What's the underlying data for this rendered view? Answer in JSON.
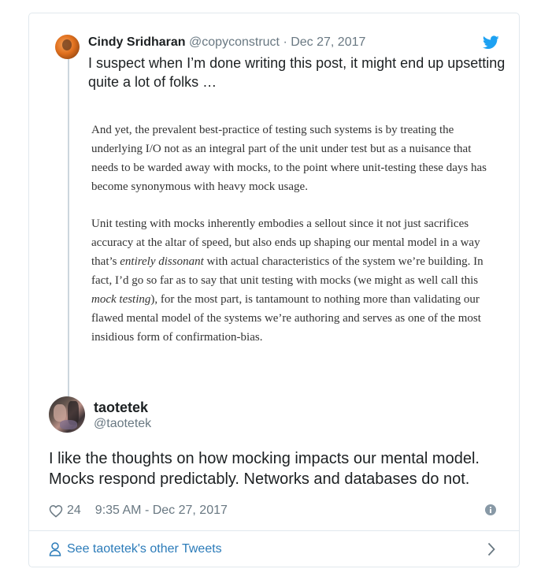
{
  "quoted_tweet": {
    "author_name": "Cindy Sridharan",
    "author_handle": "@copyconstruct",
    "separator": "·",
    "date": "Dec 27, 2017",
    "text": "I suspect when I’m done writing this post, it might end up upsetting quite a lot of folks …",
    "excerpt": {
      "p1": "And yet, the prevalent best-practice of testing such systems is by treating the underlying I/O not as an integral part of the unit under test but as a nuisance that needs to be warded away with mocks, to the point where unit-testing these days has become synonymous with heavy mock usage.",
      "p2_a": "Unit testing with mocks inherently embodies a sellout since it not just sacrifices accuracy at the altar of speed, but also ends up shaping our mental model in a way that’s ",
      "p2_em1": "entirely dissonant",
      "p2_b": " with actual characteristics of the system we’re building. In fact, I’d go so far as to say that unit testing with mocks (we might as well call this ",
      "p2_em2": "mock testing",
      "p2_c": "), for the most part, is tantamount to nothing more than validating our flawed mental model of the systems we’re authoring and serves as one of the most insidious form of confirmation-bias."
    }
  },
  "reply_tweet": {
    "author_name": "taotetek",
    "author_handle": "@taotetek",
    "text": "I like the thoughts on how mocking impacts our mental model. Mocks respond predictably. Networks and databases do not.",
    "like_count": "24",
    "timestamp": "9:35 AM - Dec 27, 2017"
  },
  "footer": {
    "link_label": "See taotetek's other Tweets"
  },
  "icons": {
    "brand": "twitter-bird-icon",
    "like": "heart-icon",
    "info": "info-icon",
    "profile": "person-icon",
    "next": "chevron-right-icon"
  },
  "colors": {
    "twitter_blue": "#1da1f2",
    "link_blue": "#2b7bb9",
    "secondary_text": "#697882",
    "border": "#e1e8ed"
  }
}
